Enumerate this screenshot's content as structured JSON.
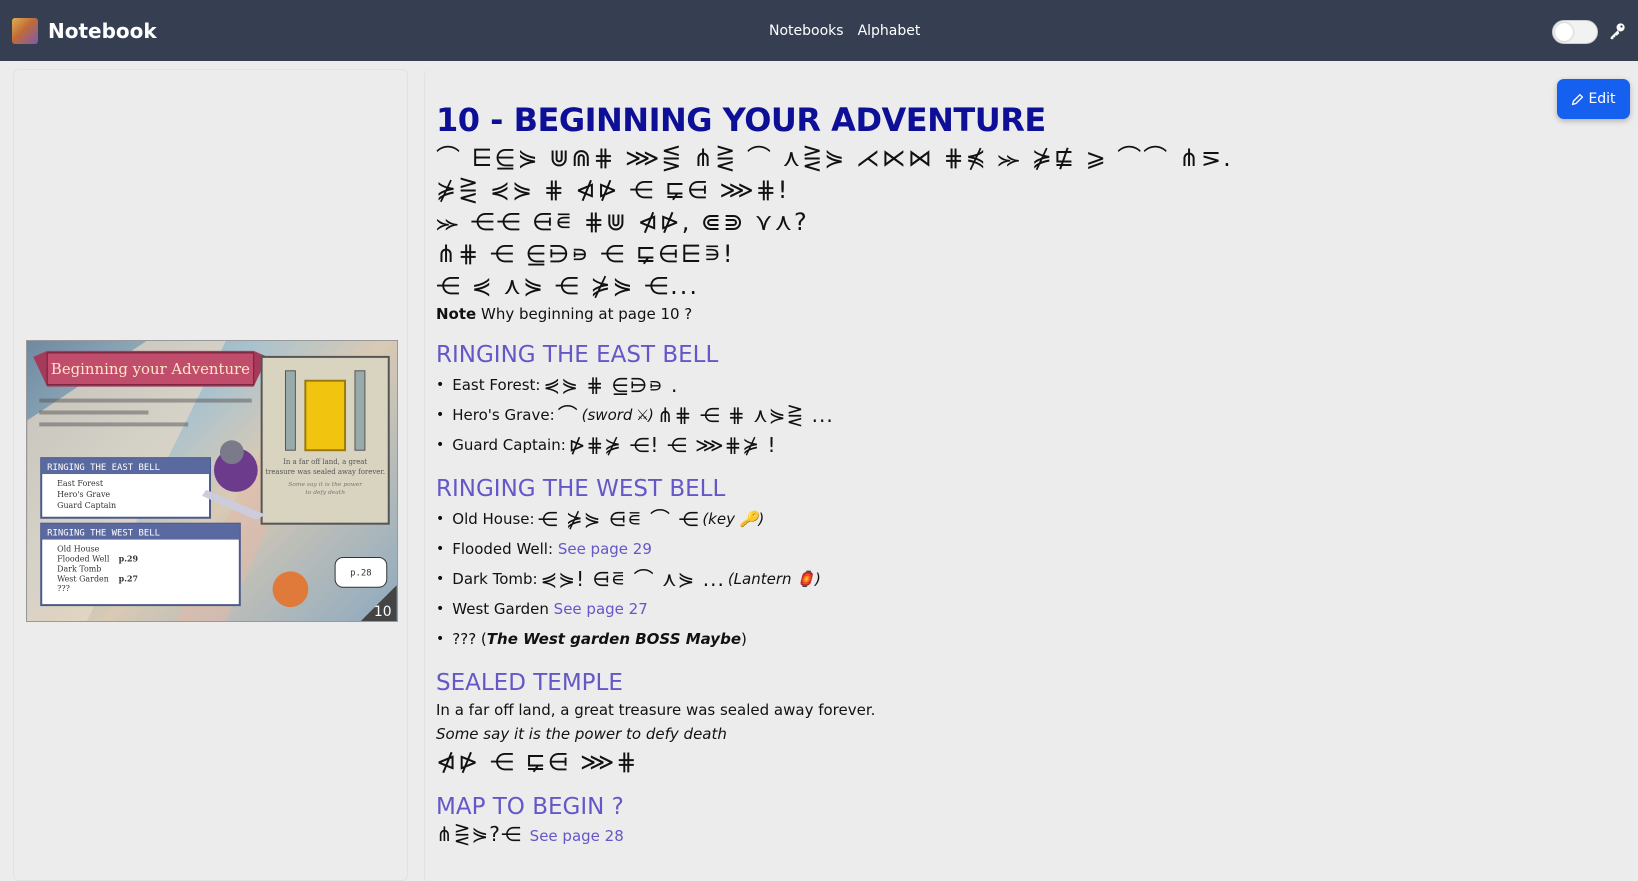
{
  "app": {
    "title": "Notebook"
  },
  "nav": {
    "notebooks": "Notebooks",
    "alphabet": "Alphabet"
  },
  "toolbar": {
    "edit_label": "Edit"
  },
  "colors": {
    "navbar": "#363f52",
    "title": "#0d0f96",
    "heading": "#6457c7",
    "button": "#1660f0"
  },
  "image": {
    "banner": "Beginning your Adventure",
    "east_title": "RINGING THE EAST BELL",
    "east_items": [
      "East Forest",
      "Hero's Grave",
      "Guard Captain"
    ],
    "west_title": "RINGING THE WEST BELL",
    "west_items": [
      "Old House",
      "Flooded Well",
      "Dark Tomb",
      "West Garden",
      "???"
    ],
    "west_values": [
      "",
      "p.29",
      "",
      "p.27",
      ""
    ],
    "caption1": "In a far off land, a great",
    "caption2": "treasure was sealed away forever.",
    "caption3": "Some say it is the power",
    "caption4": "to defy death",
    "bubble": "p.28",
    "page_number": "10"
  },
  "page": {
    "title": "10 - BEGINNING YOUR ADVENTURE",
    "glyph_lines": [
      "⌒ ⋿⋸⋟ ⋓⋒⋕ ⋙⋚ ⋔⋛ ⌒ ⋏⋛⋟ ⋌⋉⋈ ⋕⋠ ⪼ ⋡⋢ ⩾ ⌒⌒ ⋔⋝.",
      "⋡⋛ ⋞⋟ ⋕ ⋪⋫ ⋲ ⋤⋳ ⋙⋕!",
      "⪼ ⋲⋲ ⋳⋷ ⋕⋓ ⋪⋫, ⋐⋑ ⋎⋏?",
      "⋔⋕ ⋲ ⋸⋻⋼ ⋲ ⋤⋳⋿⋾!",
      "⋲ ⋞ ⋏⋟ ⋲ ⋡⋟ ⋲..."
    ],
    "note_label": "Note",
    "note_text": "Why beginning at page 10 ?",
    "east": {
      "heading": "RINGING THE EAST BELL",
      "items": [
        {
          "label": "East Forest:",
          "glyphs": "⋞⋟ ⋕ ⋸⋻⋼ ."
        },
        {
          "label": "Hero's Grave:",
          "pre": "⌒",
          "em": "(sword ⚔)",
          "glyphs": "⋔⋕ ⋲ ⋕ ⋏⋟⋛ ..."
        },
        {
          "label": "Guard Captain:",
          "glyphs": "⋫⋕⋡ ⋲! ⋲ ⋙⋕⋡ !"
        }
      ]
    },
    "west": {
      "heading": "RINGING THE WEST BELL",
      "old_house_label": "Old House:",
      "old_house_glyphs": "⋲ ⋡⋟ ⋳⋷ ⌒ ⋲",
      "old_house_key": "(key 🔑)",
      "flooded_label": "Flooded Well:",
      "flooded_link": "See page 29",
      "dark_tomb_label": "Dark Tomb:",
      "dark_tomb_glyphs": "⋞⋟! ⋳⋷ ⌒ ⋏⋟ ...",
      "dark_tomb_em": "(Lantern 🏮)",
      "garden_label": "West Garden",
      "garden_link": "See page 27",
      "unknown_label": "???",
      "unknown_em": "The West garden BOSS Maybe"
    },
    "temple": {
      "heading": "SEALED TEMPLE",
      "line1": "In a far off land, a great treasure was sealed away forever.",
      "line2": "Some say it is the power to defy death",
      "glyphs": "⋪⋫ ⋲ ⋤⋳ ⋙⋕"
    },
    "map": {
      "heading": "MAP TO BEGIN ?",
      "glyphs": "⋔⋛⋟?⋲",
      "link": "See page 28"
    }
  }
}
